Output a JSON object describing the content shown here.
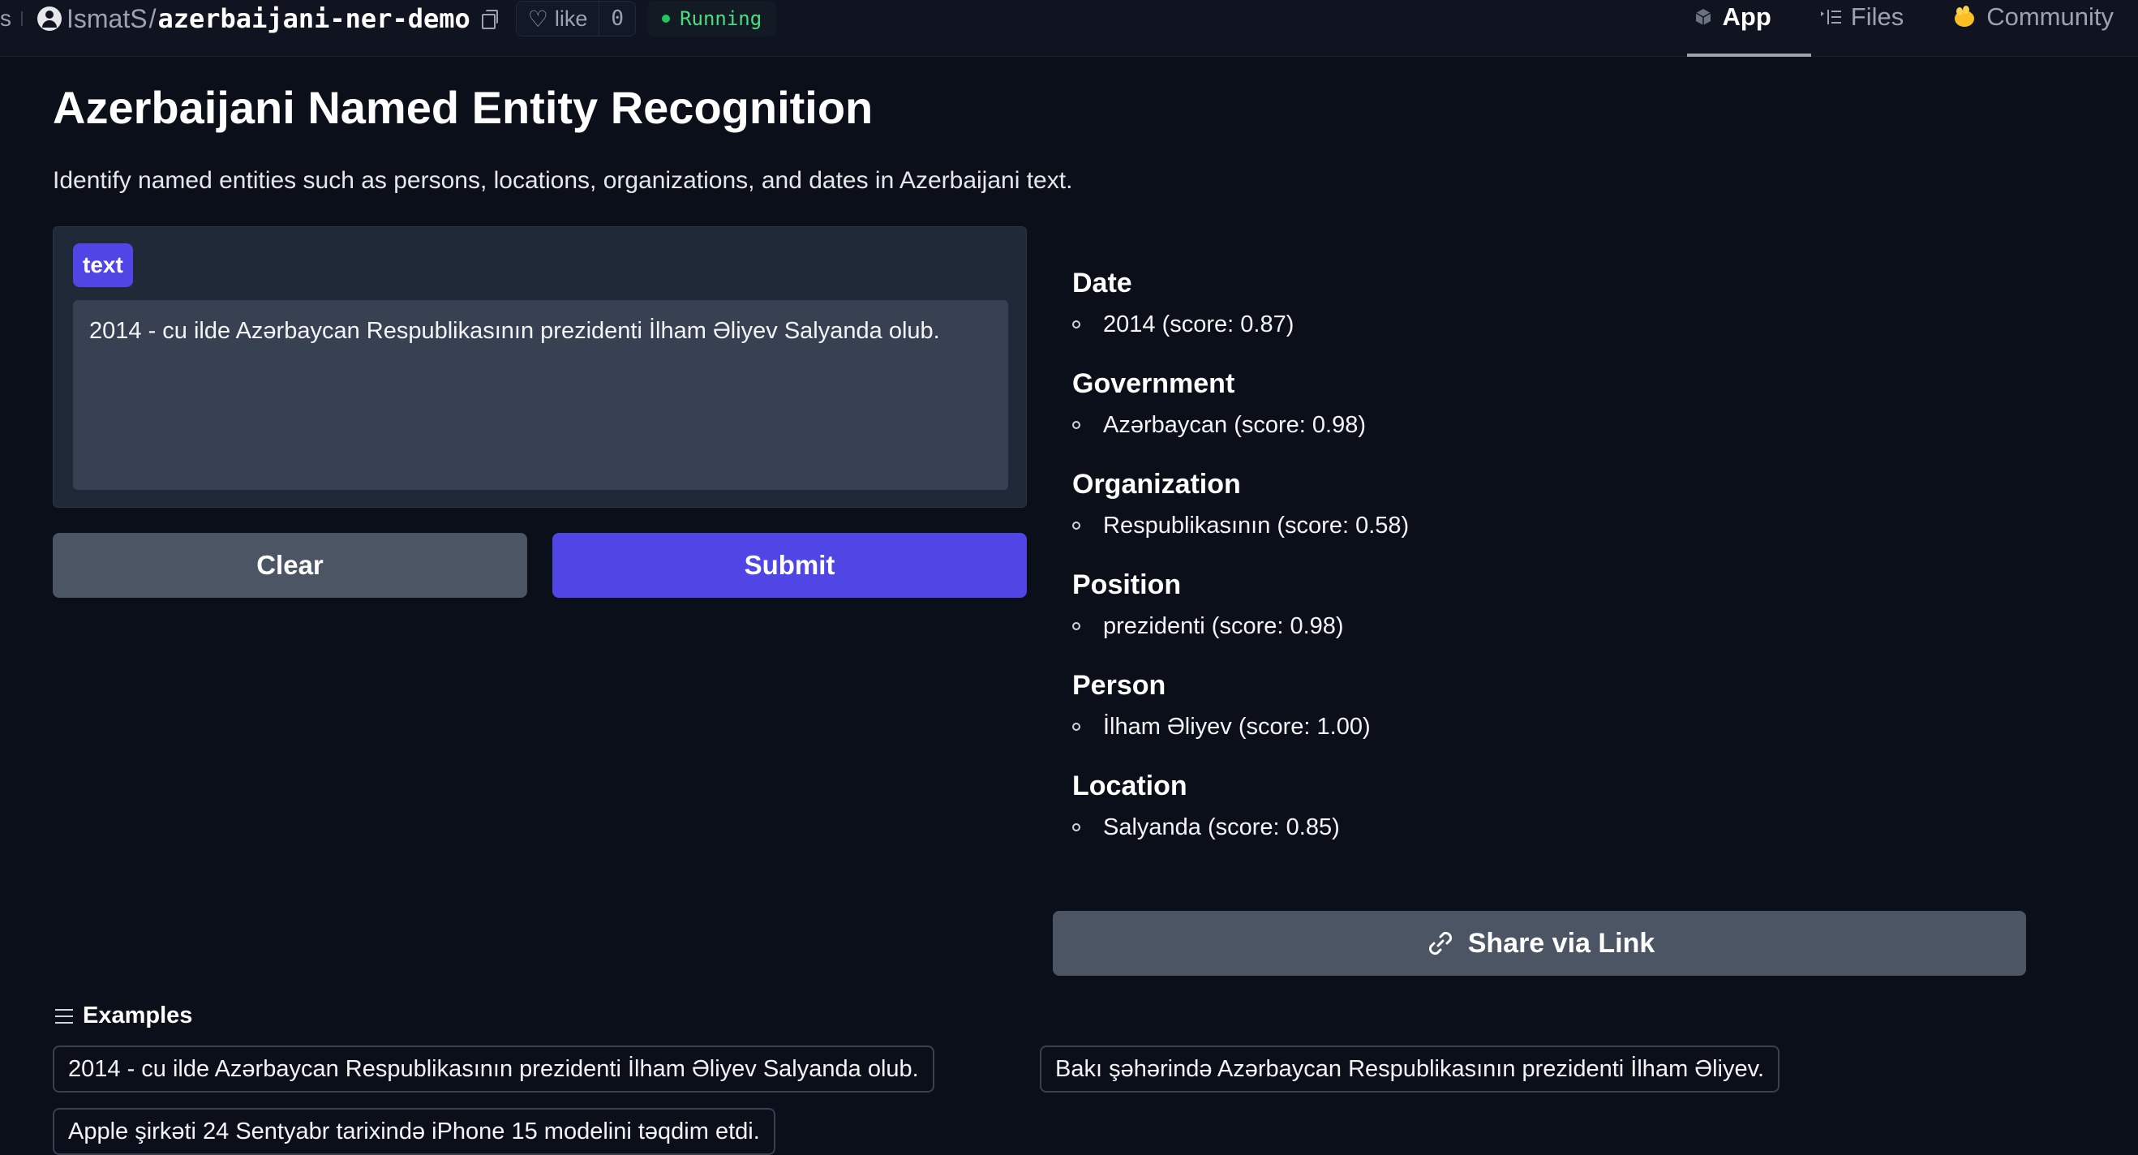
{
  "header": {
    "edge_glyph": "s",
    "owner": "IsmatS",
    "separator": "/",
    "repo": "azerbaijani-ner-demo",
    "like_label": "like",
    "like_count": "0",
    "status": "Running",
    "tabs": [
      {
        "label": "App",
        "icon": "cube-icon"
      },
      {
        "label": "Files",
        "icon": "files-icon"
      },
      {
        "label": "Community",
        "icon": "community-icon"
      }
    ]
  },
  "main": {
    "title": "Azerbaijani Named Entity Recognition",
    "subtitle": "Identify named entities such as persons, locations, organizations, and dates in Azerbaijani text.",
    "input": {
      "label": "text",
      "value": "2014 - cu ilde Azərbaycan Respublikasının prezidenti İlham Əliyev Salyanda olub."
    },
    "buttons": {
      "clear": "Clear",
      "submit": "Submit",
      "share": "Share via Link"
    },
    "entities": [
      {
        "type": "Date",
        "items": [
          "2014 (score: 0.87)"
        ]
      },
      {
        "type": "Government",
        "items": [
          "Azərbaycan (score: 0.98)"
        ]
      },
      {
        "type": "Organization",
        "items": [
          "Respublikasının (score: 0.58)"
        ]
      },
      {
        "type": "Position",
        "items": [
          "prezidenti (score: 0.98)"
        ]
      },
      {
        "type": "Person",
        "items": [
          "İlham Əliyev (score: 1.00)"
        ]
      },
      {
        "type": "Location",
        "items": [
          "Salyanda (score: 0.85)"
        ]
      }
    ],
    "examples": {
      "heading": "Examples",
      "items": [
        "2014 - cu ilde Azərbaycan Respublikasının prezidenti İlham Əliyev Salyanda olub.",
        "Bakı şəhərində Azərbaycan Respublikasının prezidenti İlham Əliyev.",
        "Apple şirkəti 24 Sentyabr tarixində iPhone 15 modelini təqdim etdi."
      ]
    }
  },
  "colors": {
    "background": "#0b0f19",
    "accent": "#4f46e5",
    "status_green": "#22c55e",
    "button_gray": "#4b5563"
  }
}
